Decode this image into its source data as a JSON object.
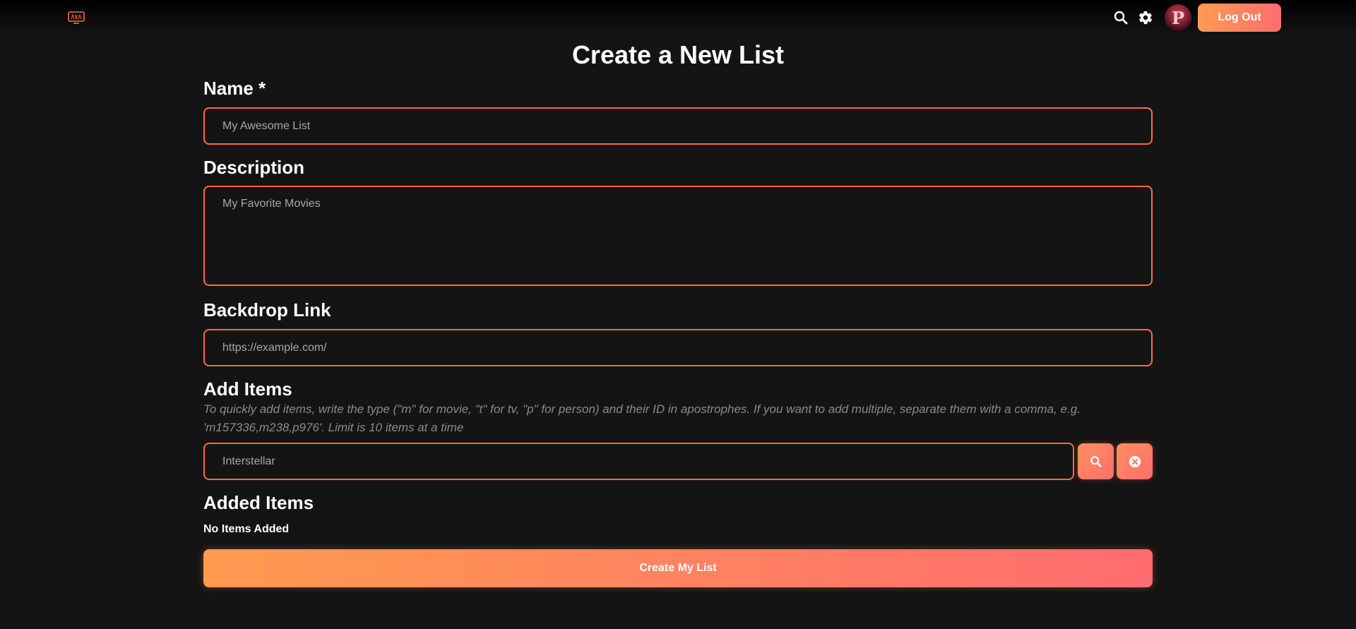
{
  "header": {
    "logo_icon": "tv-logo-icon",
    "search_icon": "search-icon",
    "settings_icon": "gear-icon",
    "avatar_letter": "P",
    "logout_label": "Log Out",
    "accent_color": "#ff6a3d"
  },
  "page": {
    "title": "Create a New List"
  },
  "form": {
    "name_label": "Name *",
    "name_placeholder": "My Awesome List",
    "description_label": "Description",
    "description_placeholder": "My Favorite Movies",
    "backdrop_label": "Backdrop Link",
    "backdrop_placeholder": "https://example.com/",
    "add_items_label": "Add Items",
    "add_items_hint": "To quickly add items, write the type (\"m\" for movie, \"t\" for tv, \"p\" for person) and their ID in apostrophes. If you want to add multiple, separate them with a comma, e.g. 'm157336,m238,p976'. Limit is 10 items at a time",
    "add_items_placeholder": "Interstellar",
    "search_button_icon": "search-icon",
    "clear_button_icon": "close-circle-icon",
    "added_items_label": "Added Items",
    "added_items_empty": "No Items Added",
    "submit_label": "Create My List"
  }
}
